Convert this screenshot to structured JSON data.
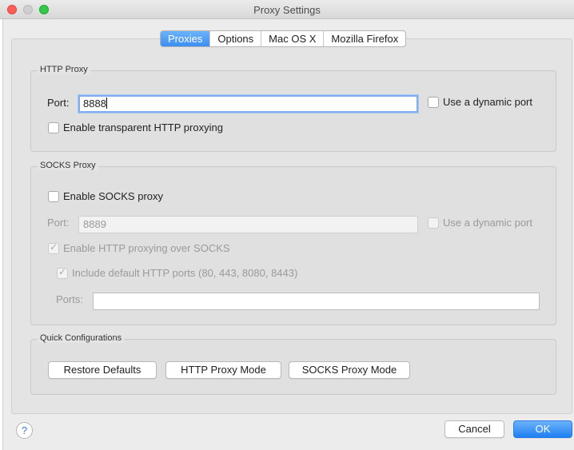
{
  "window": {
    "title": "Proxy Settings"
  },
  "tabs": [
    {
      "label": "Proxies",
      "active": true
    },
    {
      "label": "Options",
      "active": false
    },
    {
      "label": "Mac OS X",
      "active": false
    },
    {
      "label": "Mozilla Firefox",
      "active": false
    }
  ],
  "http_proxy": {
    "legend": "HTTP Proxy",
    "port_label": "Port:",
    "port_value": "8888",
    "dynamic_port_label": "Use a dynamic port",
    "dynamic_port_checked": false,
    "transparent_label": "Enable transparent HTTP proxying",
    "transparent_checked": false
  },
  "socks_proxy": {
    "legend": "SOCKS Proxy",
    "enable_label": "Enable SOCKS proxy",
    "enable_checked": false,
    "port_label": "Port:",
    "port_value": "8889",
    "dynamic_port_label": "Use a dynamic port",
    "http_over_socks_label": "Enable HTTP proxying over SOCKS",
    "http_over_socks_checked": true,
    "include_default_label": "Include default HTTP ports (80, 443, 8080, 8443)",
    "include_default_checked": true,
    "ports_label": "Ports:",
    "ports_value": ""
  },
  "quick": {
    "legend": "Quick Configurations",
    "restore_label": "Restore Defaults",
    "http_mode_label": "HTTP Proxy Mode",
    "socks_mode_label": "SOCKS Proxy Mode"
  },
  "footer": {
    "help_label": "?",
    "cancel_label": "Cancel",
    "ok_label": "OK"
  },
  "colors": {
    "accent": "#3c8ef3",
    "close": "#fc5f57",
    "maximize": "#34c84a"
  }
}
